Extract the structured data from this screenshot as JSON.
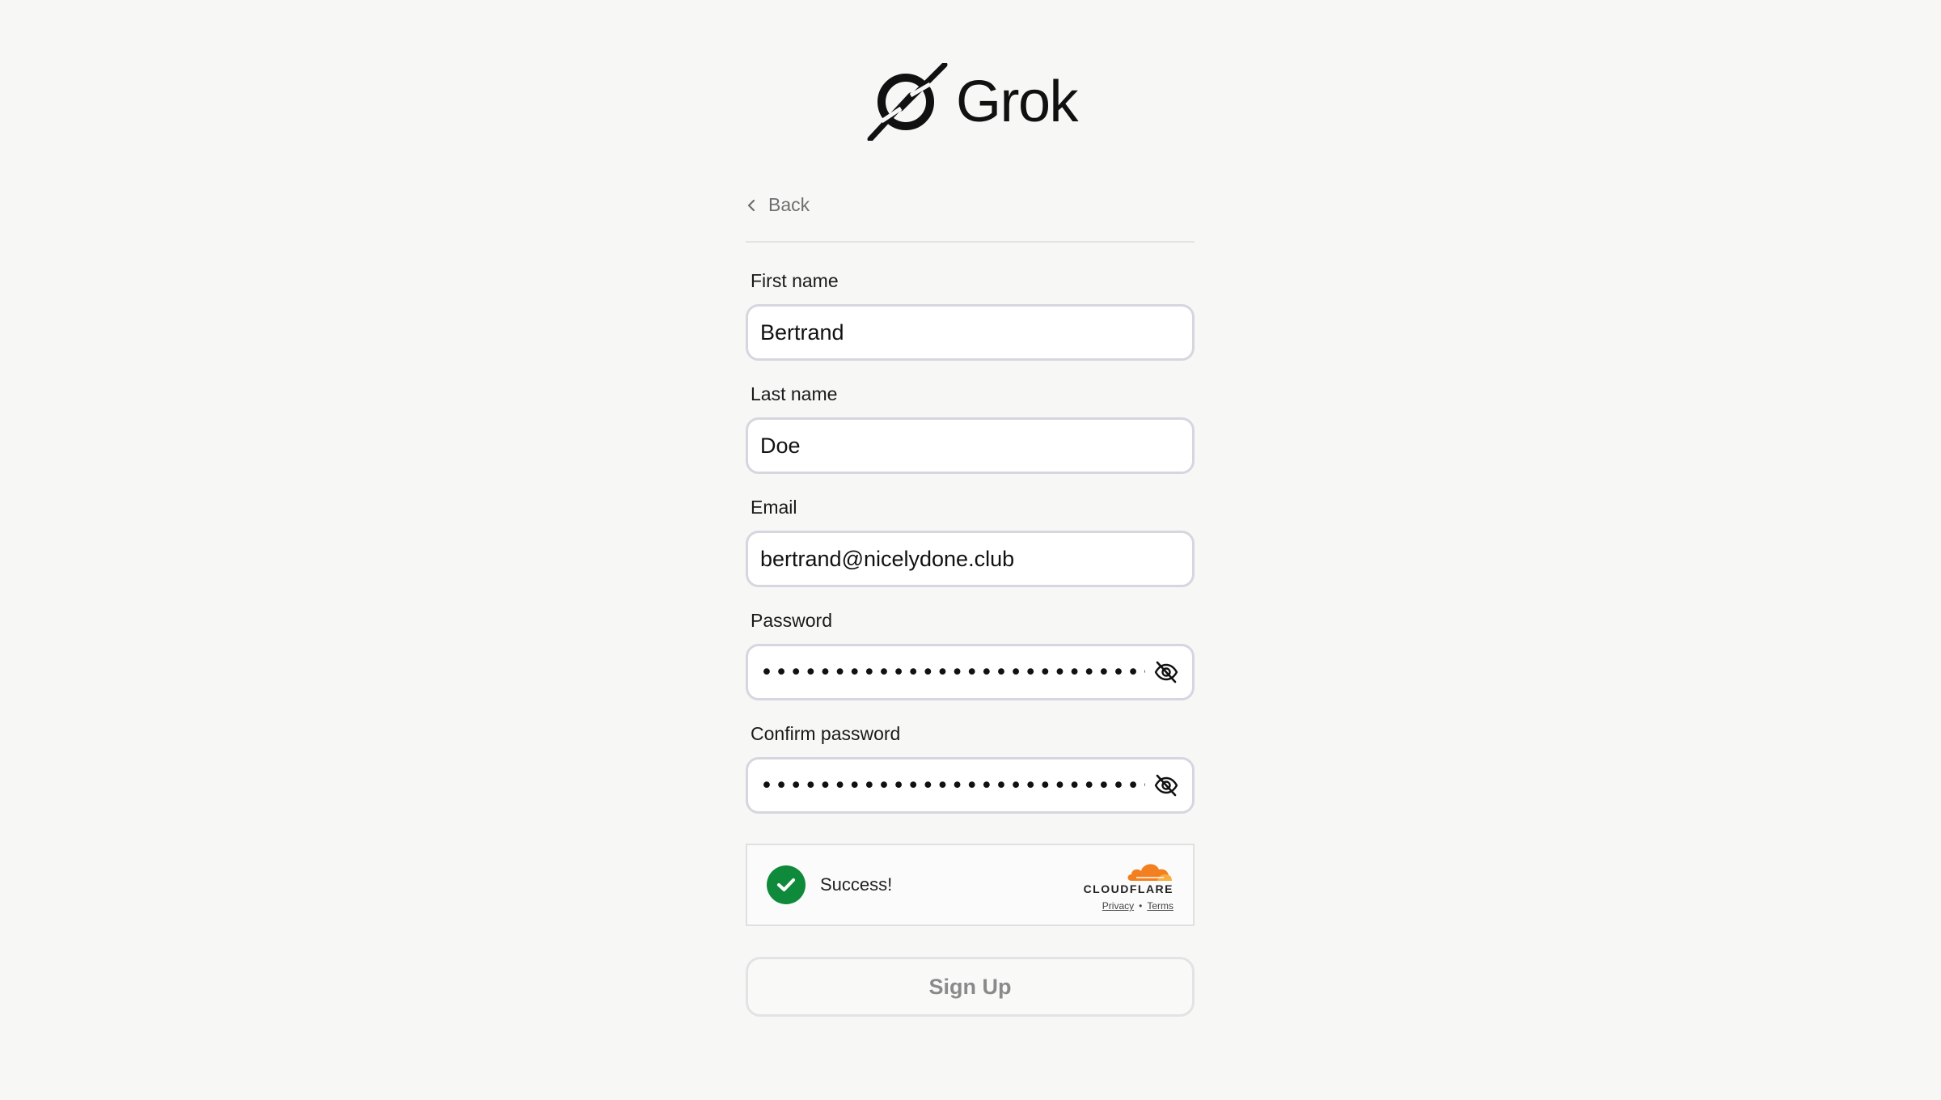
{
  "brand": {
    "name": "Grok",
    "logo_icon": "grok-logo-icon"
  },
  "nav": {
    "back_label": "Back"
  },
  "form": {
    "first_name": {
      "label": "First name",
      "value": "Bertrand"
    },
    "last_name": {
      "label": "Last name",
      "value": "Doe"
    },
    "email": {
      "label": "Email",
      "value": "bertrand@nicelydone.club"
    },
    "password": {
      "label": "Password",
      "masked": "••••••••••••••••••••••••••••••",
      "toggle_icon": "eye-off-icon"
    },
    "confirm_password": {
      "label": "Confirm password",
      "masked": "••••••••••••••••••••••••••••••",
      "toggle_icon": "eye-off-icon"
    }
  },
  "captcha": {
    "status": "Success!",
    "provider": "CLOUDFLARE",
    "privacy": "Privacy",
    "separator": "•",
    "terms": "Terms",
    "success_color": "#0f8a3a",
    "brand_color": "#f38020"
  },
  "submit": {
    "label": "Sign Up"
  }
}
